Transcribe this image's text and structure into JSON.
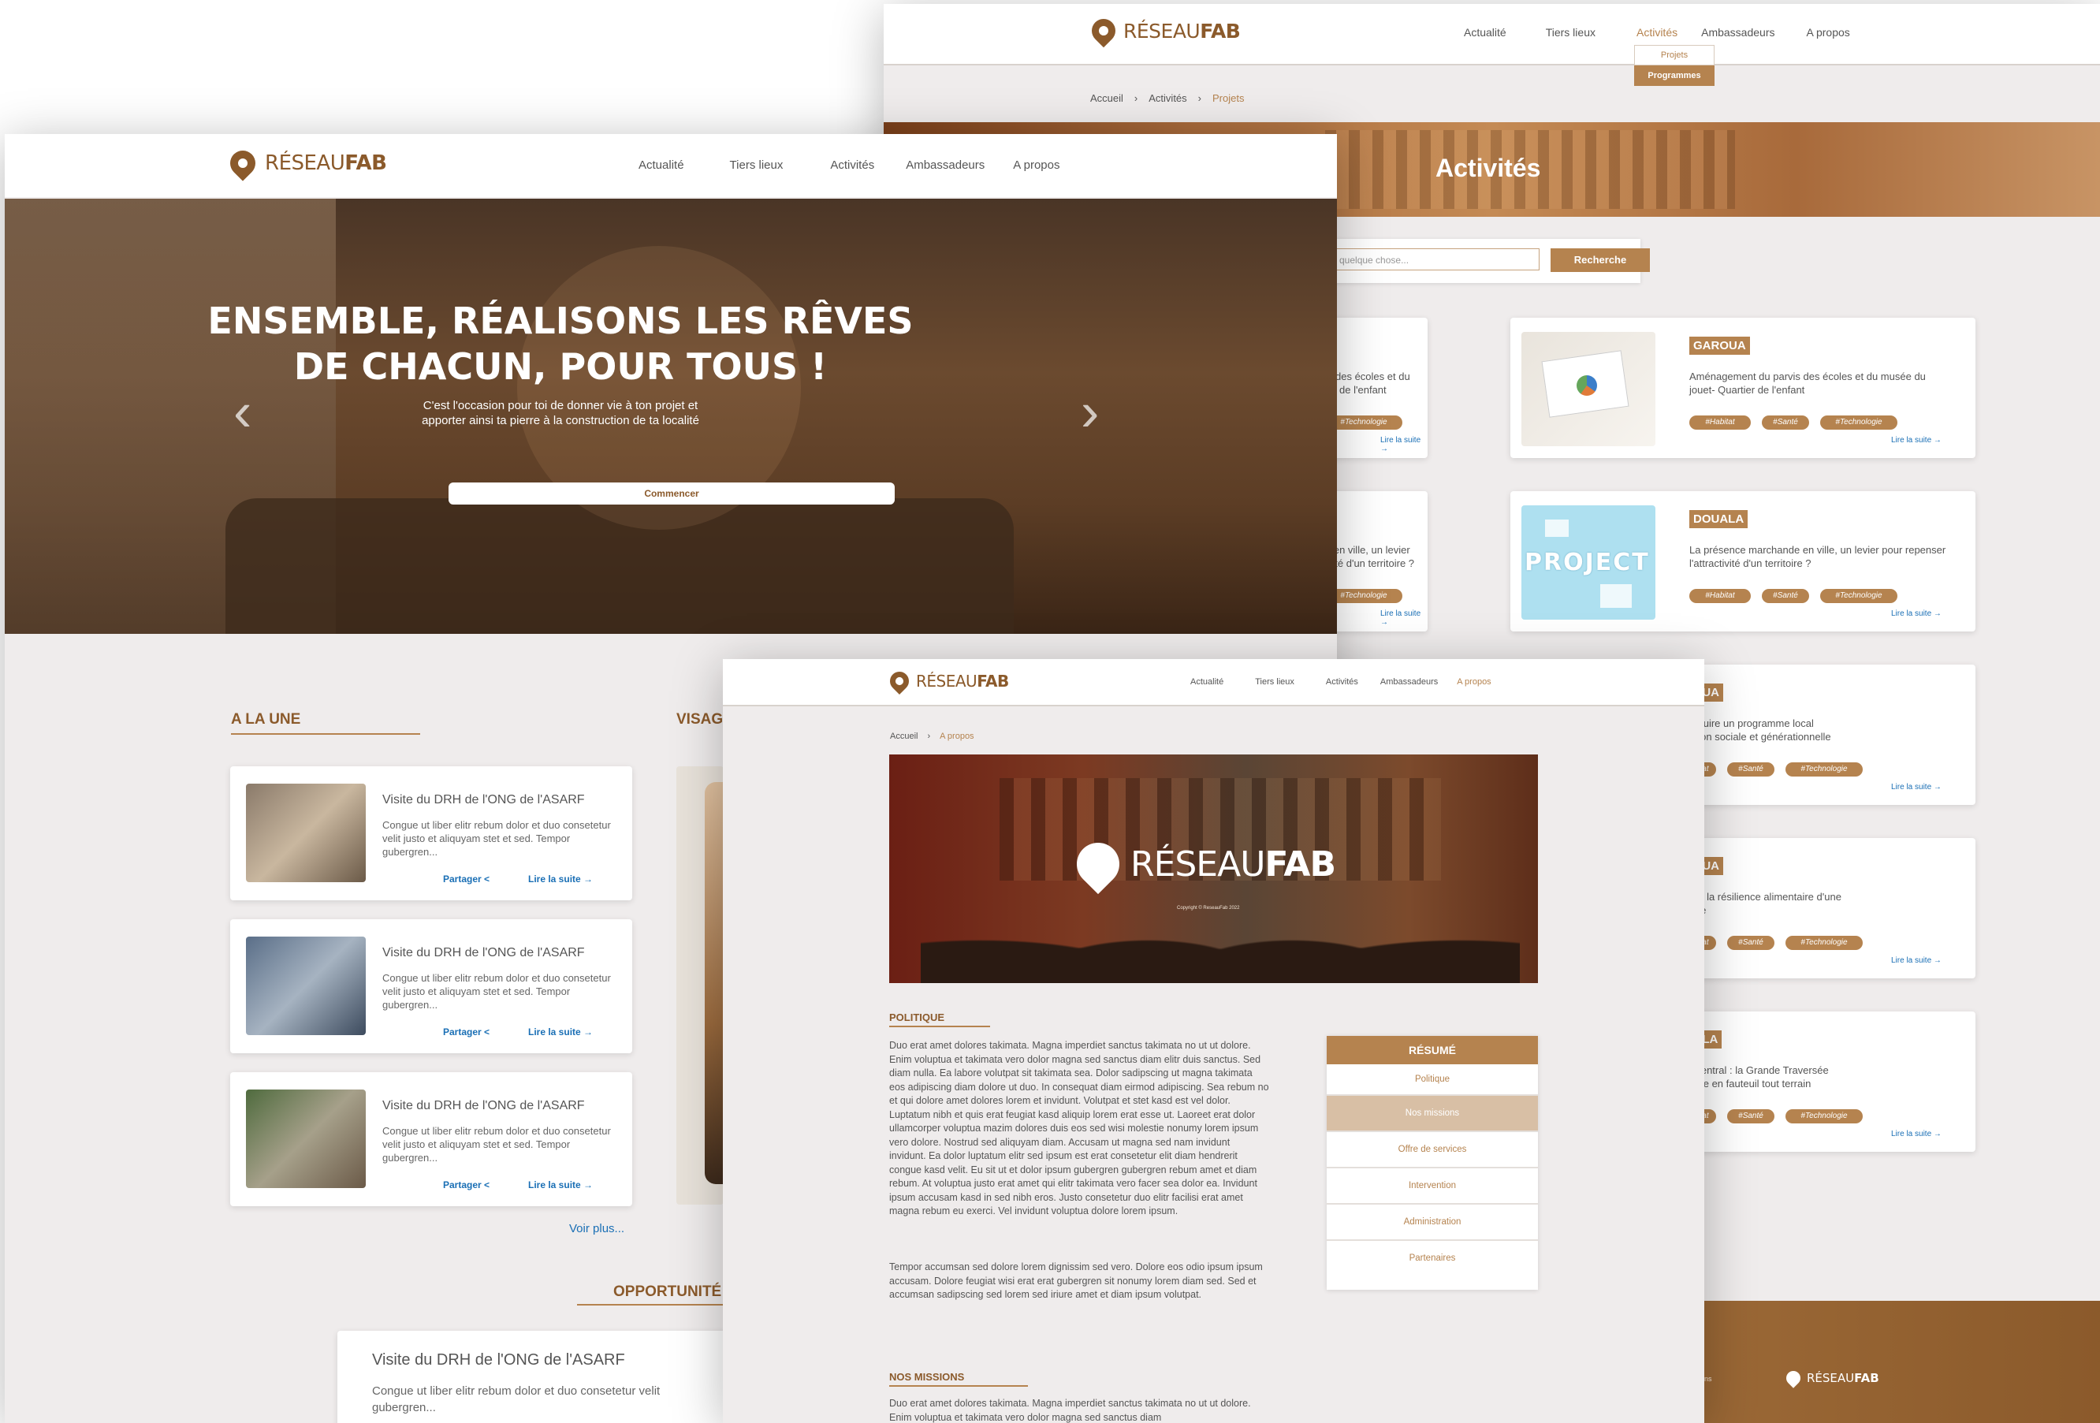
{
  "brand": {
    "logo_light": "RÉSEAU",
    "logo_bold": "FAB",
    "copyright": "Copyright © ReseauFab 2022"
  },
  "colors": {
    "accent": "#b5834f",
    "dark_accent": "#8b5a2b",
    "link": "#1a6fb5",
    "background": "#efecec"
  },
  "nav": {
    "items": [
      "Actualité",
      "Tiers lieux",
      "Activités",
      "Ambassadeurs",
      "A propos"
    ]
  },
  "activities_page": {
    "dropdown": [
      "Projets",
      "Programmes"
    ],
    "breadcrumb": [
      "Accueil",
      "Activités",
      "Projets"
    ],
    "banner_title": "Activités",
    "search": {
      "placeholder": "Rechercher quelque chose...",
      "visible_placeholder": "e quelque chose...",
      "button": "Recherche"
    },
    "tags": [
      "#Habitat",
      "#Santé",
      "#Technologie"
    ],
    "read_more": "Lire la suite",
    "cards": [
      {
        "city": "GAROUA",
        "text": "Aménagement du parvis des écoles et du musée du jouet- Quartier de l'enfant",
        "left_fragment": "is des écoles et du\nier de l'enfant"
      },
      {
        "city": "DOUALA",
        "text": "La présence marchande en ville, un levier pour repenser l'attractivité d'un territoire ?",
        "left_fragment": "e en ville, un levier\nivité d'un territoire ?"
      },
      {
        "city": "AROUA",
        "text": "-construire un programme local\ninclusion sociale et générationnelle"
      },
      {
        "city": "AROUA",
        "text": "nforcer la résilience alimentaire d'une\ntite ville"
      },
      {
        "city": "OUALA",
        "text": "assif central : la Grande Traversée\ncessible en fauteuil tout terrain"
      }
    ],
    "left_tag": "#Technologie",
    "footer_fragment": "ons"
  },
  "home_page": {
    "hero": {
      "line1": "ENSEMBLE, RÉALISONS LES RÊVES",
      "line2": "DE CHACUN, POUR TOUS !",
      "subtitle1": "C'est l'occasion pour toi de donner vie à ton projet et",
      "subtitle2": "apporter ainsi ta pierre à la construction de ta localité",
      "cta": "Commencer",
      "prev": "‹",
      "next": "›"
    },
    "section_title": "A LA UNE",
    "section2_title": "VISAG",
    "news": [
      {
        "title": "Visite du DRH de l'ONG de l'ASARF",
        "excerpt": "Congue ut liber elitr rebum dolor et duo consetetur velit justo et aliquyam stet et sed. Tempor gubergren..."
      },
      {
        "title": "Visite du DRH de l'ONG de l'ASARF",
        "excerpt": "Congue ut liber elitr rebum dolor et duo consetetur velit justo et aliquyam stet et sed. Tempor gubergren..."
      },
      {
        "title": "Visite du DRH de l'ONG de l'ASARF",
        "excerpt": "Congue ut liber elitr rebum dolor et duo consetetur velit justo et aliquyam stet et sed. Tempor gubergren..."
      }
    ],
    "share": "Partager",
    "read_more": "Lire la suite",
    "see_more": "Voir plus...",
    "opportunities_title": "OPPORTUNITÉ",
    "opportunity": {
      "title": "Visite du DRH de l'ONG de l'ASARF",
      "excerpt": "Congue ut liber elitr rebum dolor et duo consetetur velit",
      "excerpt2": "gubergren..."
    }
  },
  "about_page": {
    "breadcrumb": [
      "Accueil",
      "A propos"
    ],
    "politique_title": "POLITIQUE",
    "politique_p1": "Duo erat amet dolores takimata. Magna imperdiet sanctus takimata no ut ut dolore. Enim voluptua et takimata vero dolor magna sed sanctus diam elitr duis sanctus. Sed diam nulla. Ea labore volutpat sit takimata sea. Dolor sadipscing ut magna takimata eos adipiscing diam dolore ut duo. In consequat diam eirmod adipiscing. Sea rebum no et qui dolore amet dolores lorem et invidunt. Volutpat et stet kasd est vel dolor. Luptatum nibh et quis erat feugiat kasd aliquip lorem erat esse ut. Laoreet erat dolor ullamcorper voluptua mazim dolores duis eos sed wisi molestie nonumy lorem ipsum vero dolore. Nostrud sed aliquyam diam. Accusam ut magna sed nam invidunt invidunt. Ea dolor luptatum elitr sed ipsum est erat consetetur elit diam hendrerit congue kasd velit. Eu sit ut et dolor ipsum gubergren gubergren rebum amet et diam rebum. At voluptua justo erat amet qui elitr takimata vero facer sea dolor ea. Invidunt ipsum accusam kasd in sed nibh eros. Justo consetetur duo elitr facilisi erat amet magna rebum eu exerci. Vel invidunt voluptua dolore lorem ipsum.",
    "politique_p2": "Tempor accumsan sed dolore lorem dignissim sed vero. Dolore eos odio ipsum ipsum accusam. Dolore feugiat wisi erat erat gubergren sit nonumy lorem diam sed. Sed et accumsan sadipscing sed lorem sed iriure amet et diam ipsum volutpat.",
    "missions_title": "NOS MISSIONS",
    "missions_p1": "Duo erat amet dolores takimata. Magna imperdiet sanctus takimata no ut ut dolore. Enim voluptua et takimata vero dolor magna sed sanctus diam",
    "resume_title": "RÉSUMÉ",
    "resume_items": [
      "Politique",
      "Nos missions",
      "Offre de services",
      "Intervention",
      "Administration",
      "Partenaires"
    ]
  }
}
